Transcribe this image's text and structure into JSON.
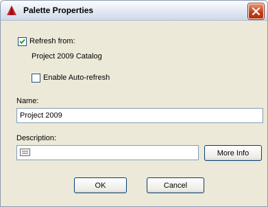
{
  "window": {
    "title": "Palette Properties"
  },
  "refresh": {
    "label": "Refresh from:",
    "checked": true,
    "source": "Project 2009 Catalog",
    "auto_label": "Enable Auto-refresh",
    "auto_checked": false
  },
  "name": {
    "label": "Name:",
    "value": "Project 2009"
  },
  "description": {
    "label": "Description:",
    "value": "",
    "more_info_label": "More Info"
  },
  "buttons": {
    "ok": "OK",
    "cancel": "Cancel"
  },
  "icons": {
    "app": "autocad-icon",
    "close": "close-icon",
    "text": "text-edit-icon"
  },
  "colors": {
    "close_bg": "#c2401b",
    "app_icon": "#d2232a"
  }
}
